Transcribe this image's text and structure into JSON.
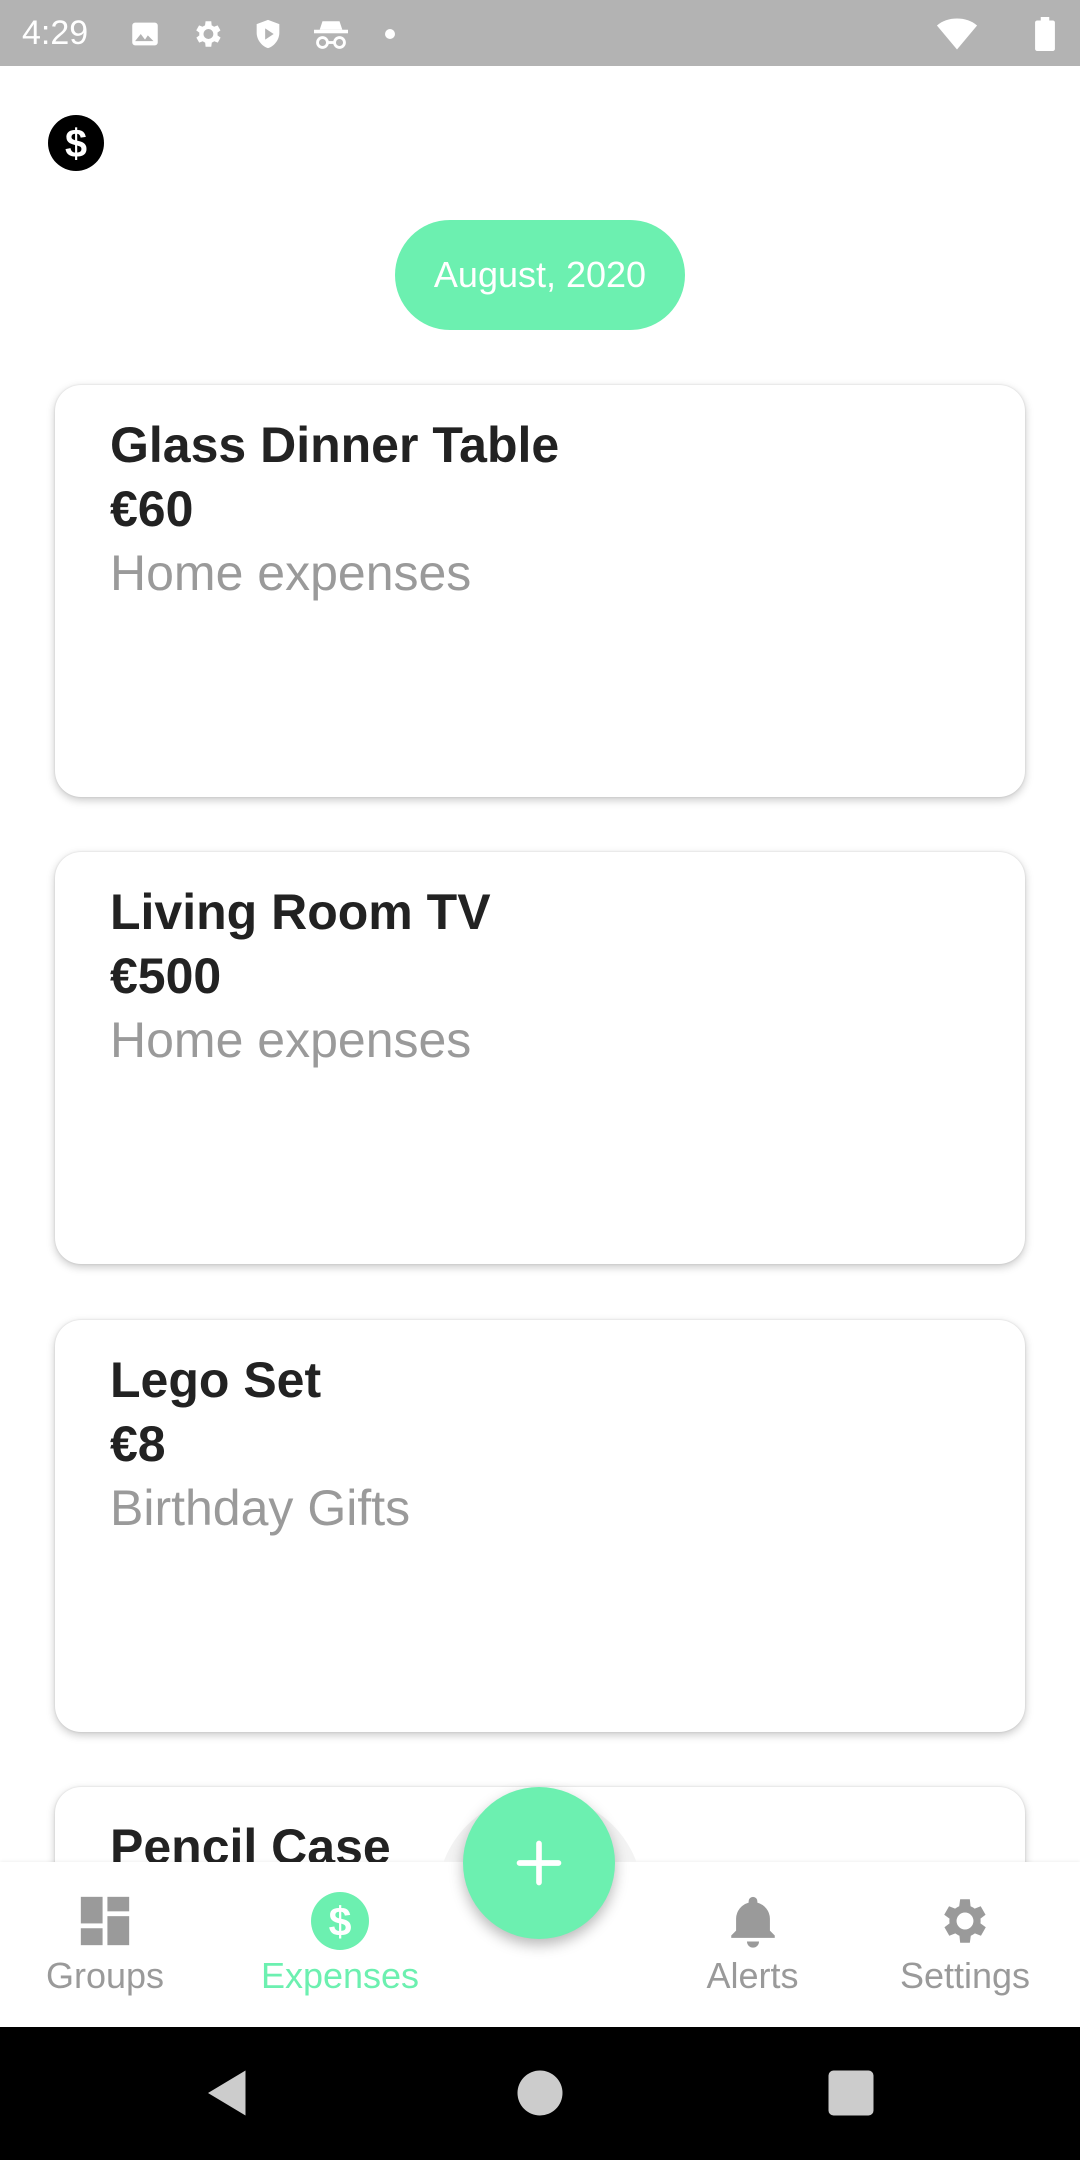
{
  "status_bar": {
    "time": "4:29",
    "icons": [
      "image-icon",
      "gear-icon",
      "shield-icon",
      "incognito-icon",
      "dot-icon",
      "wifi-icon",
      "battery-icon"
    ]
  },
  "header": {
    "logo_icon": "dollar-circle-icon",
    "month_label": "August, 2020"
  },
  "expenses": [
    {
      "title": "Glass Dinner Table",
      "amount": "€60",
      "category": "Home expenses"
    },
    {
      "title": "Living Room TV",
      "amount": "€500",
      "category": "Home expenses"
    },
    {
      "title": "Lego Set",
      "amount": "€8",
      "category": "Birthday Gifts"
    },
    {
      "title": "Pencil Case",
      "amount": "",
      "category": ""
    }
  ],
  "bottom_nav": {
    "items": [
      {
        "label": "Groups",
        "icon": "dashboard-icon",
        "active": false
      },
      {
        "label": "Expenses",
        "icon": "dollar-circle-icon",
        "active": true
      },
      {
        "label": "Alerts",
        "icon": "bell-icon",
        "active": false
      },
      {
        "label": "Settings",
        "icon": "gear-icon",
        "active": false
      }
    ],
    "fab_icon": "plus-icon"
  },
  "colors": {
    "accent": "#6cf0b0",
    "status_bar": "#b3b3b3",
    "text_primary": "#222222",
    "text_secondary": "#9a9a9a"
  }
}
